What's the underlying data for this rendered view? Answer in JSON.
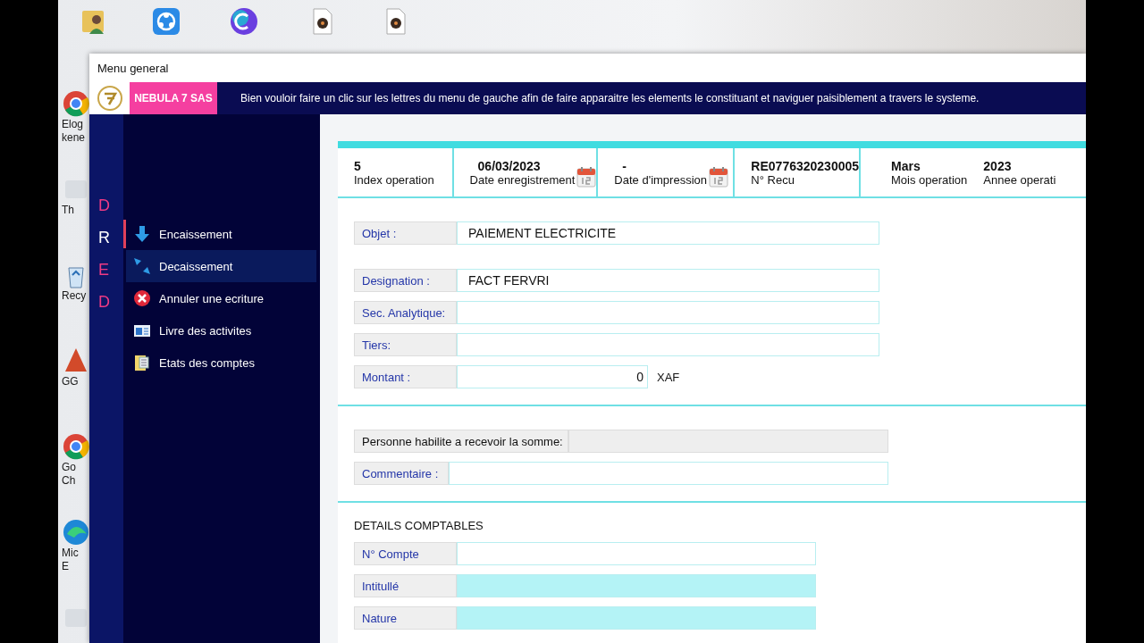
{
  "desktop": {
    "top_icons": [
      {
        "kind": "user-folder"
      },
      {
        "kind": "share"
      },
      {
        "kind": "canva"
      },
      {
        "kind": "music-file"
      },
      {
        "kind": "music-file"
      }
    ],
    "side_icons": [
      {
        "kind": "chrome",
        "lines": [
          "Elog",
          "kene"
        ]
      },
      {
        "kind": "app",
        "lines": [
          "Th"
        ]
      },
      {
        "kind": "recycle",
        "lines": [
          "Recy"
        ]
      },
      {
        "kind": "red-app",
        "lines": [
          "GG"
        ]
      },
      {
        "kind": "chrome",
        "lines": [
          "Go",
          "Ch"
        ]
      },
      {
        "kind": "edge",
        "lines": [
          "Mic",
          "E"
        ]
      },
      {
        "kind": "app"
      }
    ]
  },
  "window": {
    "title": "Menu general"
  },
  "header": {
    "company": "NEBULA 7 SAS",
    "message": "Bien vouloir faire un clic sur les lettres du menu de gauche afin de faire apparaitre les elements le constituant et naviguer paisiblement a travers le systeme."
  },
  "letters": [
    {
      "label": "D",
      "selected": false
    },
    {
      "label": "R",
      "selected": true
    },
    {
      "label": "E",
      "selected": false
    },
    {
      "label": "D",
      "selected": false
    }
  ],
  "menu": [
    {
      "label": "Encaissement",
      "selected": false
    },
    {
      "label": "Decaissement",
      "selected": true
    },
    {
      "label": "Annuler une ecriture",
      "selected": false
    },
    {
      "label": "Livre des activites",
      "selected": false
    },
    {
      "label": "Etats des comptes",
      "selected": false
    }
  ],
  "info": [
    {
      "kind": "text",
      "items": [
        {
          "value": "5",
          "label": "Index operation"
        }
      ]
    },
    {
      "kind": "date",
      "items": [
        {
          "value": "06/03/2023",
          "label": "Date enregistrement"
        }
      ]
    },
    {
      "kind": "date",
      "items": [
        {
          "value": "-",
          "label": "Date d'impression"
        }
      ]
    },
    {
      "kind": "text",
      "items": [
        {
          "value": "RE0776320230005",
          "label": "N° Recu"
        }
      ]
    },
    {
      "kind": "text",
      "items": [
        {
          "value": "Mars",
          "label": "Mois operation"
        },
        {
          "value": "2023",
          "label": "Annee operati"
        }
      ]
    }
  ],
  "fields": [
    {
      "label": "Objet :",
      "value": "PAIEMENT ELECTRICITE"
    },
    {
      "label": "Designation :",
      "value": "FACT FERVRI"
    },
    {
      "label": "Sec. Analytique:"
    },
    {
      "label": "Tiers:"
    },
    {
      "label": "Montant :",
      "value": "0",
      "unit": "XAF"
    }
  ],
  "person": {
    "label": "Personne habilite a recevoir la somme:"
  },
  "comment": {
    "label": "Commentaire :"
  },
  "details": {
    "title": "DETAILS COMPTABLES",
    "fields": [
      {
        "label": "N°  Compte",
        "kind": "input"
      },
      {
        "label": "Intitullé",
        "kind": "readonly"
      },
      {
        "label": "Nature",
        "kind": "readonly"
      }
    ]
  }
}
